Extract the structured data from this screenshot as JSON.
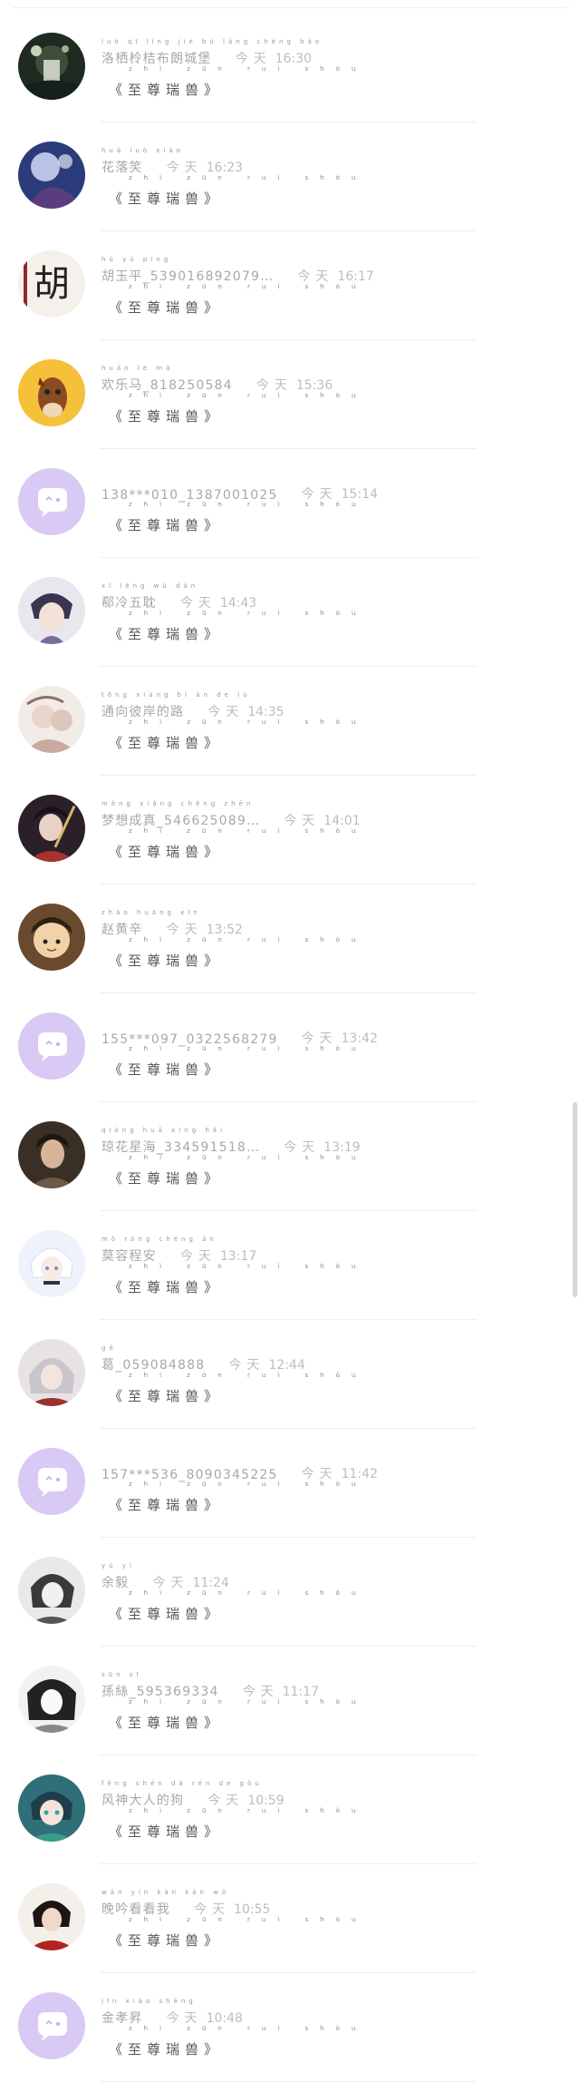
{
  "messages": [
    {
      "name": "洛栖柃桔布朗城堡",
      "pinyin": "luò qī líng jié bù lǎng chéng bǎo",
      "date": "今天",
      "time": "16:30",
      "text": "《至尊瑞兽》",
      "text_pinyin": "zhì zūn ruì shòu",
      "avatar": "dark-forest-avatar"
    },
    {
      "name": "花落笑",
      "pinyin": "huā luò xiào",
      "date": "今天",
      "time": "16:23",
      "text": "《至尊瑞兽》",
      "text_pinyin": "zhì zūn ruì shòu",
      "avatar": "blue-anime-avatar"
    },
    {
      "name": "胡玉平_539016892079…",
      "pinyin": "hú yù píng",
      "date": "今天",
      "time": "16:17",
      "text": "《至尊瑞兽》",
      "text_pinyin": "zhì zūn ruì shòu",
      "avatar": "calligraphy-avatar"
    },
    {
      "name": "欢乐马_818250584",
      "pinyin": "huān lè mǎ",
      "date": "今天",
      "time": "15:36",
      "text": "《至尊瑞兽》",
      "text_pinyin": "zhì zūn ruì shòu",
      "avatar": "horse-cartoon-avatar"
    },
    {
      "name": "138***010_1387001025",
      "pinyin": "",
      "date": "今天",
      "time": "15:14",
      "text": "《至尊瑞兽》",
      "text_pinyin": "zhì zūn ruì shòu",
      "avatar": "default-purple-avatar"
    },
    {
      "name": "郗冷五耽",
      "pinyin": "xī lěng wǔ dān",
      "date": "今天",
      "time": "14:43",
      "text": "《至尊瑞兽》",
      "text_pinyin": "zhì zūn ruì shòu",
      "avatar": "anime-boy-avatar"
    },
    {
      "name": "通向彼岸的路",
      "pinyin": "tōng xiàng bǐ àn de lù",
      "date": "今天",
      "time": "14:35",
      "text": "《至尊瑞兽》",
      "text_pinyin": "zhì zūn ruì shòu",
      "avatar": "anime-pair-avatar"
    },
    {
      "name": "梦想成真_546625089…",
      "pinyin": "mèng xiǎng chéng zhēn",
      "date": "今天",
      "time": "14:01",
      "text": "《至尊瑞兽》",
      "text_pinyin": "zhì zūn ruì shòu",
      "avatar": "anime-swordsman-avatar"
    },
    {
      "name": "赵黄辛",
      "pinyin": "zhào huáng xīn",
      "date": "今天",
      "time": "13:52",
      "text": "《至尊瑞兽》",
      "text_pinyin": "zhì zūn ruì shòu",
      "avatar": "chibi-warrior-avatar"
    },
    {
      "name": "155***097_0322568279",
      "pinyin": "",
      "date": "今天",
      "time": "13:42",
      "text": "《至尊瑞兽》",
      "text_pinyin": "zhì zūn ruì shòu",
      "avatar": "default-purple-avatar"
    },
    {
      "name": "琼花星海_334591518…",
      "pinyin": "qióng huā xīng hǎi",
      "date": "今天",
      "time": "13:19",
      "text": "《至尊瑞兽》",
      "text_pinyin": "zhì zūn ruì shòu",
      "avatar": "dark-portrait-avatar"
    },
    {
      "name": "莫容程安",
      "pinyin": "mò róng chéng ān",
      "date": "今天",
      "time": "13:17",
      "text": "《至尊瑞兽》",
      "text_pinyin": "zhì zūn ruì shòu",
      "avatar": "white-hair-avatar"
    },
    {
      "name": "葛_059084888",
      "pinyin": "gě",
      "date": "今天",
      "time": "12:44",
      "text": "《至尊瑞兽》",
      "text_pinyin": "zhì zūn ruì shòu",
      "avatar": "silver-hair-avatar"
    },
    {
      "name": "157***536_8090345225",
      "pinyin": "",
      "date": "今天",
      "time": "11:42",
      "text": "《至尊瑞兽》",
      "text_pinyin": "zhì zūn ruì shòu",
      "avatar": "default-purple-avatar"
    },
    {
      "name": "余毅",
      "pinyin": "yú yì",
      "date": "今天",
      "time": "11:24",
      "text": "《至尊瑞兽》",
      "text_pinyin": "zhì zūn ruì shòu",
      "avatar": "sketch-portrait-avatar"
    },
    {
      "name": "孫絲_595369334",
      "pinyin": "sūn sī",
      "date": "今天",
      "time": "11:17",
      "text": "《至尊瑞兽》",
      "text_pinyin": "zhì zūn ruì shòu",
      "avatar": "monochrome-anime-avatar"
    },
    {
      "name": "风神大人的狗",
      "pinyin": "fēng shén dà rén de gǒu",
      "date": "今天",
      "time": "10:59",
      "text": "《至尊瑞兽》",
      "text_pinyin": "zhì zūn ruì shòu",
      "avatar": "teal-anime-avatar"
    },
    {
      "name": "晚吟看看我",
      "pinyin": "wǎn yín kàn kàn wǒ",
      "date": "今天",
      "time": "10:55",
      "text": "《至尊瑞兽》",
      "text_pinyin": "zhì zūn ruì shòu",
      "avatar": "red-robe-avatar"
    },
    {
      "name": "金孝昇",
      "pinyin": "jīn xiào shēng",
      "date": "今天",
      "time": "10:48",
      "text": "《至尊瑞兽》",
      "text_pinyin": "zhì zūn ruì shòu",
      "avatar": "default-purple-avatar"
    }
  ],
  "colors": {
    "default_avatar_bg": "#d9c9f5",
    "name": "#a8a8a8",
    "message": "#555555"
  }
}
